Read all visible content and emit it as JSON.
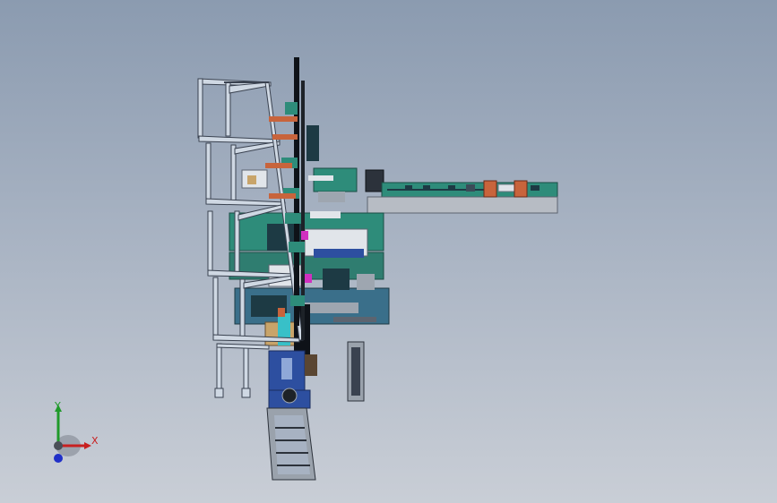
{
  "viewport": {
    "background_top": "#8b9bb0",
    "background_bottom": "#c9ced6"
  },
  "model": {
    "frame_color": "#cfd8e3",
    "frame_edge_color": "#3a4250",
    "machine_green": "#2e8c7a",
    "machine_dark": "#1d3a44",
    "accent_orange": "#c8643c",
    "accent_magenta": "#d030c0",
    "conveyor_blue": "#2d4fa0",
    "fixture_gray": "#b7bcc4"
  },
  "axis_triad": {
    "x_label": "X",
    "y_label": "Y",
    "x_color": "#c82020",
    "y_color": "#1f9a2a",
    "z_color": "#2030c8"
  }
}
